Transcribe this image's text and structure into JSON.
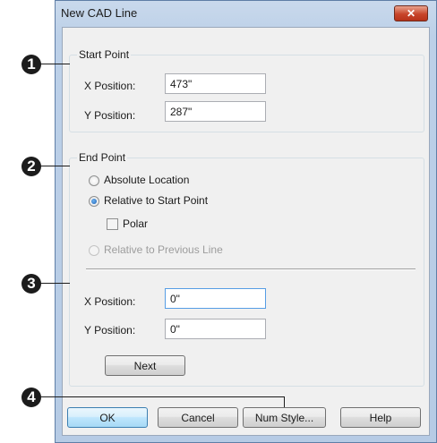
{
  "dialog": {
    "title": "New CAD Line"
  },
  "start_point": {
    "legend": "Start Point",
    "x_label": "X Position:",
    "x_value": "473\"",
    "y_label": "Y Position:",
    "y_value": "287\""
  },
  "end_point": {
    "legend": "End Point",
    "radio_absolute": "Absolute Location",
    "radio_relative_start": "Relative to Start Point",
    "selected": "Relative to Start Point",
    "polar_label": "Polar",
    "polar_checked": false,
    "radio_relative_previous": "Relative to Previous Line",
    "x_label": "X Position:",
    "x_value": "0\"",
    "y_label": "Y Position:",
    "y_value": "0\"",
    "next_label": "Next"
  },
  "buttons": {
    "ok": "OK",
    "cancel": "Cancel",
    "num_style": "Num Style...",
    "help": "Help"
  },
  "callouts": [
    "1",
    "2",
    "3",
    "4"
  ],
  "icons": {
    "close": "close-x-icon"
  },
  "colors": {
    "titlebar": "#bcd0e8",
    "close_button": "#c7452a",
    "default_button": "#3c7fb1"
  }
}
